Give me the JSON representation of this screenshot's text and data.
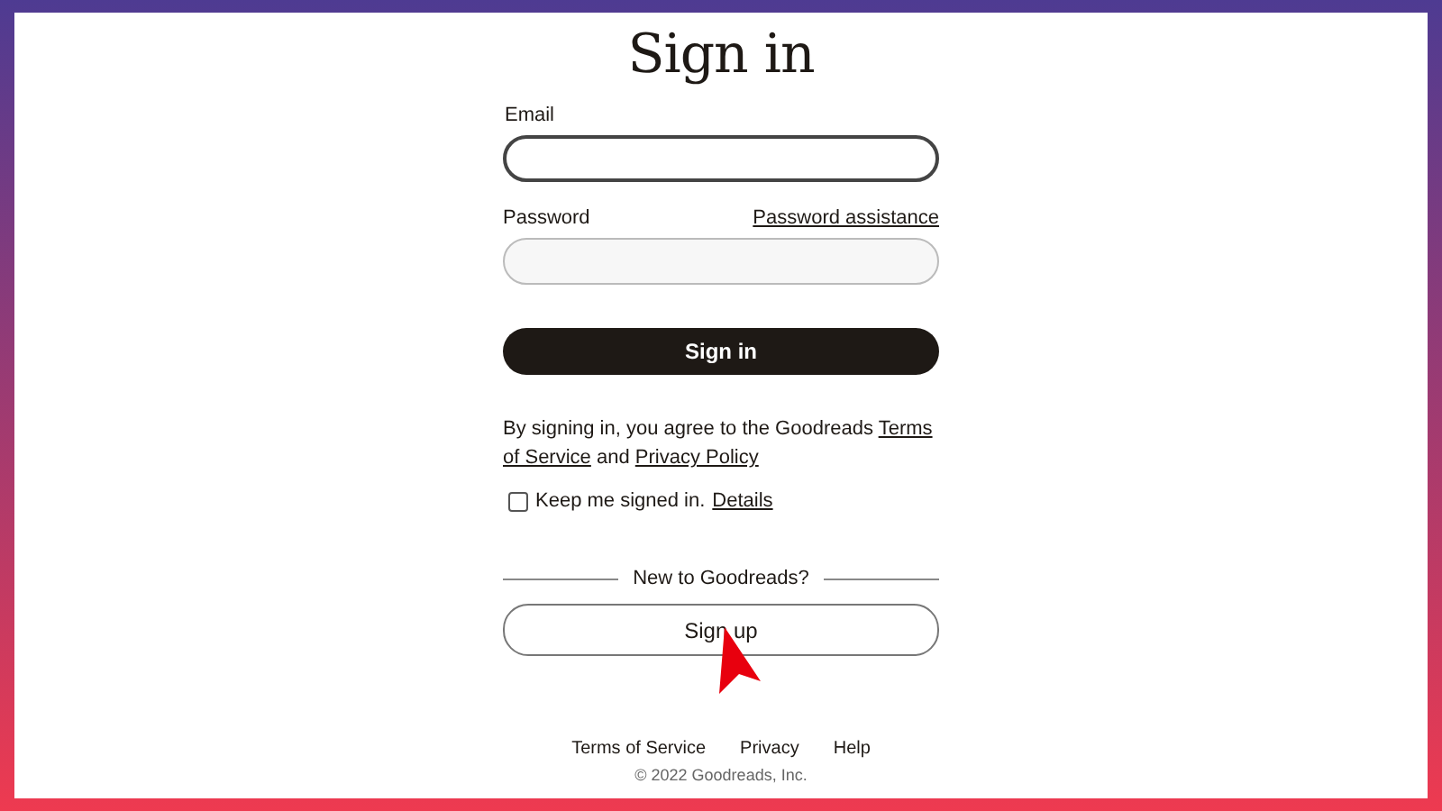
{
  "title": "Sign in",
  "email": {
    "label": "Email"
  },
  "password": {
    "label": "Password",
    "assist_link": "Password assistance"
  },
  "sign_in_button": "Sign in",
  "agreement": {
    "before": "By signing in, you agree to the Goodreads ",
    "terms_link": "Terms of Service",
    "middle": " and ",
    "privacy_link": "Privacy Policy"
  },
  "keep_signed_in": {
    "checked": false,
    "label": "Keep me signed in.",
    "details_link": "Details"
  },
  "divider_text": "New to Goodreads?",
  "sign_up_button": "Sign up",
  "footer_links": [
    "Terms of Service",
    "Privacy",
    "Help"
  ],
  "copyright": "© 2022 Goodreads, Inc."
}
